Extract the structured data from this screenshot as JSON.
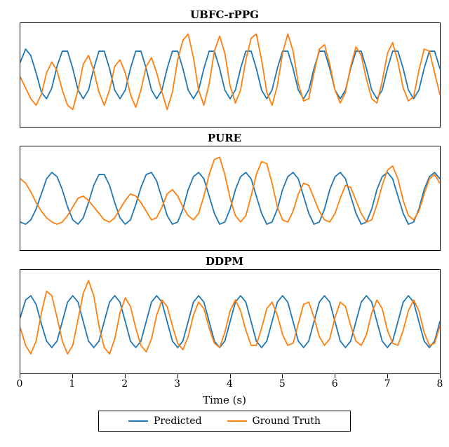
{
  "chart_data": [
    {
      "type": "line",
      "title": "UBFC-rPPG",
      "xlabel": "Time (s)",
      "ylabel": "",
      "xlim": [
        0,
        8
      ],
      "ylim": [
        -1.2,
        1.2
      ],
      "grid": false,
      "legend": {
        "entries": [
          "Predicted",
          "Ground Truth"
        ],
        "position": "bottom"
      },
      "series": [
        {
          "name": "Predicted",
          "color": "#1f77b4",
          "x": [
            0.0,
            0.1,
            0.2,
            0.3,
            0.4,
            0.5,
            0.6,
            0.7,
            0.8,
            0.9,
            1.0,
            1.1,
            1.2,
            1.3,
            1.4,
            1.5,
            1.6,
            1.7,
            1.8,
            1.9,
            2.0,
            2.1,
            2.2,
            2.3,
            2.4,
            2.5,
            2.6,
            2.7,
            2.8,
            2.9,
            3.0,
            3.1,
            3.2,
            3.3,
            3.4,
            3.5,
            3.6,
            3.7,
            3.8,
            3.9,
            4.0,
            4.1,
            4.2,
            4.3,
            4.4,
            4.5,
            4.6,
            4.7,
            4.8,
            4.9,
            5.0,
            5.1,
            5.2,
            5.3,
            5.4,
            5.5,
            5.6,
            5.7,
            5.8,
            5.9,
            6.0,
            6.1,
            6.2,
            6.3,
            6.4,
            6.5,
            6.6,
            6.7,
            6.8,
            6.9,
            7.0,
            7.1,
            7.2,
            7.3,
            7.4,
            7.5,
            7.6,
            7.7,
            7.8,
            7.9,
            8.0
          ],
          "values": [
            0.3,
            0.6,
            0.45,
            0.05,
            -0.4,
            -0.55,
            -0.3,
            0.2,
            0.55,
            0.55,
            0.15,
            -0.35,
            -0.55,
            -0.35,
            0.15,
            0.55,
            0.55,
            0.15,
            -0.35,
            -0.55,
            -0.35,
            0.15,
            0.55,
            0.55,
            0.15,
            -0.35,
            -0.55,
            -0.35,
            0.15,
            0.55,
            0.55,
            0.15,
            -0.35,
            -0.55,
            -0.35,
            0.15,
            0.55,
            0.55,
            0.15,
            -0.35,
            -0.55,
            -0.35,
            0.15,
            0.55,
            0.55,
            0.15,
            -0.35,
            -0.55,
            -0.35,
            0.15,
            0.55,
            0.55,
            0.15,
            -0.35,
            -0.55,
            -0.35,
            0.15,
            0.55,
            0.55,
            0.15,
            -0.35,
            -0.55,
            -0.35,
            0.15,
            0.55,
            0.55,
            0.15,
            -0.35,
            -0.55,
            -0.35,
            0.15,
            0.55,
            0.55,
            0.15,
            -0.35,
            -0.55,
            -0.35,
            0.15,
            0.55,
            0.55,
            0.15
          ]
        },
        {
          "name": "Ground Truth",
          "color": "#ff7f0e",
          "x": [
            0.0,
            0.1,
            0.2,
            0.3,
            0.4,
            0.5,
            0.6,
            0.7,
            0.8,
            0.9,
            1.0,
            1.1,
            1.2,
            1.3,
            1.4,
            1.5,
            1.6,
            1.7,
            1.8,
            1.9,
            2.0,
            2.1,
            2.2,
            2.3,
            2.4,
            2.5,
            2.6,
            2.7,
            2.8,
            2.9,
            3.0,
            3.1,
            3.2,
            3.3,
            3.4,
            3.5,
            3.6,
            3.7,
            3.8,
            3.9,
            4.0,
            4.1,
            4.2,
            4.3,
            4.4,
            4.5,
            4.6,
            4.7,
            4.8,
            4.9,
            5.0,
            5.1,
            5.2,
            5.3,
            5.4,
            5.5,
            5.6,
            5.7,
            5.8,
            5.9,
            6.0,
            6.1,
            6.2,
            6.3,
            6.4,
            6.5,
            6.6,
            6.7,
            6.8,
            6.9,
            7.0,
            7.1,
            7.2,
            7.3,
            7.4,
            7.5,
            7.6,
            7.7,
            7.8,
            7.9,
            8.0
          ],
          "values": [
            -0.05,
            -0.3,
            -0.55,
            -0.7,
            -0.45,
            0.05,
            0.3,
            0.1,
            -0.35,
            -0.7,
            -0.8,
            -0.35,
            0.25,
            0.45,
            0.1,
            -0.4,
            -0.7,
            -0.35,
            0.2,
            0.35,
            0.05,
            -0.45,
            -0.75,
            -0.35,
            0.2,
            0.4,
            0.05,
            -0.4,
            -0.8,
            -0.4,
            0.35,
            0.8,
            0.95,
            0.4,
            -0.35,
            -0.7,
            -0.2,
            0.55,
            0.9,
            0.5,
            -0.25,
            -0.65,
            -0.35,
            0.35,
            0.85,
            0.95,
            0.35,
            -0.4,
            -0.7,
            -0.25,
            0.5,
            0.95,
            0.55,
            -0.2,
            -0.6,
            -0.55,
            0.05,
            0.6,
            0.7,
            0.25,
            -0.35,
            -0.65,
            -0.4,
            0.2,
            0.65,
            0.45,
            -0.1,
            -0.55,
            -0.65,
            -0.15,
            0.5,
            0.75,
            0.3,
            -0.3,
            -0.6,
            -0.5,
            0.1,
            0.6,
            0.55,
            0.05,
            -0.45
          ]
        }
      ]
    },
    {
      "type": "line",
      "title": "PURE",
      "xlabel": "Time (s)",
      "ylabel": "",
      "xlim": [
        0,
        8
      ],
      "ylim": [
        -1.2,
        1.2
      ],
      "grid": false,
      "legend": {
        "entries": [
          "Predicted",
          "Ground Truth"
        ],
        "position": "bottom"
      },
      "series": [
        {
          "name": "Predicted",
          "color": "#1f77b4",
          "x": [
            0.0,
            0.1,
            0.2,
            0.3,
            0.4,
            0.5,
            0.6,
            0.7,
            0.8,
            0.9,
            1.0,
            1.1,
            1.2,
            1.3,
            1.4,
            1.5,
            1.6,
            1.7,
            1.8,
            1.9,
            2.0,
            2.1,
            2.2,
            2.3,
            2.4,
            2.5,
            2.6,
            2.7,
            2.8,
            2.9,
            3.0,
            3.1,
            3.2,
            3.3,
            3.4,
            3.5,
            3.6,
            3.7,
            3.8,
            3.9,
            4.0,
            4.1,
            4.2,
            4.3,
            4.4,
            4.5,
            4.6,
            4.7,
            4.8,
            4.9,
            5.0,
            5.1,
            5.2,
            5.3,
            5.4,
            5.5,
            5.6,
            5.7,
            5.8,
            5.9,
            6.0,
            6.1,
            6.2,
            6.3,
            6.4,
            6.5,
            6.6,
            6.7,
            6.8,
            6.9,
            7.0,
            7.1,
            7.2,
            7.3,
            7.4,
            7.5,
            7.6,
            7.7,
            7.8,
            7.9,
            8.0
          ],
          "values": [
            -0.55,
            -0.6,
            -0.5,
            -0.25,
            0.1,
            0.45,
            0.6,
            0.5,
            0.2,
            -0.2,
            -0.5,
            -0.6,
            -0.45,
            -0.1,
            0.3,
            0.55,
            0.55,
            0.3,
            -0.1,
            -0.45,
            -0.6,
            -0.5,
            -0.15,
            0.25,
            0.55,
            0.6,
            0.4,
            0.0,
            -0.4,
            -0.6,
            -0.55,
            -0.25,
            0.2,
            0.5,
            0.6,
            0.45,
            0.05,
            -0.35,
            -0.6,
            -0.55,
            -0.25,
            0.2,
            0.5,
            0.6,
            0.45,
            0.05,
            -0.35,
            -0.6,
            -0.55,
            -0.25,
            0.2,
            0.5,
            0.6,
            0.45,
            0.05,
            -0.35,
            -0.6,
            -0.55,
            -0.25,
            0.2,
            0.5,
            0.6,
            0.45,
            0.05,
            -0.35,
            -0.6,
            -0.55,
            -0.25,
            0.2,
            0.5,
            0.6,
            0.45,
            0.05,
            -0.35,
            -0.6,
            -0.55,
            -0.25,
            0.2,
            0.5,
            0.6,
            0.45
          ]
        },
        {
          "name": "Ground Truth",
          "color": "#ff7f0e",
          "x": [
            0.0,
            0.1,
            0.2,
            0.3,
            0.4,
            0.5,
            0.6,
            0.7,
            0.8,
            0.9,
            1.0,
            1.1,
            1.2,
            1.3,
            1.4,
            1.5,
            1.6,
            1.7,
            1.8,
            1.9,
            2.0,
            2.1,
            2.2,
            2.3,
            2.4,
            2.5,
            2.6,
            2.7,
            2.8,
            2.9,
            3.0,
            3.1,
            3.2,
            3.3,
            3.4,
            3.5,
            3.6,
            3.7,
            3.8,
            3.9,
            4.0,
            4.1,
            4.2,
            4.3,
            4.4,
            4.5,
            4.6,
            4.7,
            4.8,
            4.9,
            5.0,
            5.1,
            5.2,
            5.3,
            5.4,
            5.5,
            5.6,
            5.7,
            5.8,
            5.9,
            6.0,
            6.1,
            6.2,
            6.3,
            6.4,
            6.5,
            6.6,
            6.7,
            6.8,
            6.9,
            7.0,
            7.1,
            7.2,
            7.3,
            7.4,
            7.5,
            7.6,
            7.7,
            7.8,
            7.9,
            8.0
          ],
          "values": [
            0.45,
            0.35,
            0.15,
            -0.1,
            -0.3,
            -0.45,
            -0.55,
            -0.6,
            -0.55,
            -0.4,
            -0.2,
            0.0,
            0.05,
            -0.05,
            -0.2,
            -0.35,
            -0.5,
            -0.55,
            -0.45,
            -0.25,
            -0.05,
            0.1,
            0.05,
            -0.1,
            -0.3,
            -0.5,
            -0.45,
            -0.2,
            0.1,
            0.2,
            0.05,
            -0.2,
            -0.4,
            -0.5,
            -0.35,
            0.05,
            0.55,
            0.9,
            0.95,
            0.55,
            0.0,
            -0.4,
            -0.55,
            -0.4,
            0.05,
            0.55,
            0.85,
            0.8,
            0.35,
            -0.2,
            -0.5,
            -0.55,
            -0.3,
            0.1,
            0.35,
            0.3,
            0.0,
            -0.3,
            -0.5,
            -0.55,
            -0.35,
            0.0,
            0.3,
            0.25,
            -0.05,
            -0.35,
            -0.55,
            -0.5,
            -0.15,
            0.3,
            0.65,
            0.75,
            0.45,
            -0.05,
            -0.4,
            -0.5,
            -0.3,
            0.1,
            0.45,
            0.55,
            0.35
          ]
        }
      ]
    },
    {
      "type": "line",
      "title": "DDPM",
      "xlabel": "Time (s)",
      "ylabel": "",
      "xlim": [
        0,
        8
      ],
      "ylim": [
        -1.2,
        1.2
      ],
      "grid": false,
      "legend": {
        "entries": [
          "Predicted",
          "Ground Truth"
        ],
        "position": "bottom"
      },
      "series": [
        {
          "name": "Predicted",
          "color": "#1f77b4",
          "x": [
            0.0,
            0.1,
            0.2,
            0.3,
            0.4,
            0.5,
            0.6,
            0.7,
            0.8,
            0.9,
            1.0,
            1.1,
            1.2,
            1.3,
            1.4,
            1.5,
            1.6,
            1.7,
            1.8,
            1.9,
            2.0,
            2.1,
            2.2,
            2.3,
            2.4,
            2.5,
            2.6,
            2.7,
            2.8,
            2.9,
            3.0,
            3.1,
            3.2,
            3.3,
            3.4,
            3.5,
            3.6,
            3.7,
            3.8,
            3.9,
            4.0,
            4.1,
            4.2,
            4.3,
            4.4,
            4.5,
            4.6,
            4.7,
            4.8,
            4.9,
            5.0,
            5.1,
            5.2,
            5.3,
            5.4,
            5.5,
            5.6,
            5.7,
            5.8,
            5.9,
            6.0,
            6.1,
            6.2,
            6.3,
            6.4,
            6.5,
            6.6,
            6.7,
            6.8,
            6.9,
            7.0,
            7.1,
            7.2,
            7.3,
            7.4,
            7.5,
            7.6,
            7.7,
            7.8,
            7.9,
            8.0
          ],
          "values": [
            0.1,
            0.5,
            0.6,
            0.4,
            -0.05,
            -0.45,
            -0.6,
            -0.45,
            0.0,
            0.45,
            0.6,
            0.45,
            0.0,
            -0.45,
            -0.6,
            -0.45,
            0.0,
            0.45,
            0.6,
            0.45,
            0.0,
            -0.45,
            -0.6,
            -0.45,
            0.0,
            0.45,
            0.6,
            0.45,
            0.0,
            -0.45,
            -0.6,
            -0.45,
            0.0,
            0.45,
            0.6,
            0.45,
            0.0,
            -0.45,
            -0.6,
            -0.45,
            0.0,
            0.45,
            0.6,
            0.45,
            0.0,
            -0.45,
            -0.6,
            -0.45,
            0.0,
            0.45,
            0.6,
            0.45,
            0.0,
            -0.45,
            -0.6,
            -0.45,
            0.0,
            0.45,
            0.6,
            0.45,
            0.0,
            -0.45,
            -0.6,
            -0.45,
            0.0,
            0.45,
            0.6,
            0.45,
            0.0,
            -0.45,
            -0.6,
            -0.45,
            0.0,
            0.45,
            0.6,
            0.45,
            0.0,
            -0.45,
            -0.6,
            -0.45,
            0.0
          ]
        },
        {
          "name": "Ground Truth",
          "color": "#ff7f0e",
          "x": [
            0.0,
            0.1,
            0.2,
            0.3,
            0.4,
            0.5,
            0.6,
            0.7,
            0.8,
            0.9,
            1.0,
            1.1,
            1.2,
            1.3,
            1.4,
            1.5,
            1.6,
            1.7,
            1.8,
            1.9,
            2.0,
            2.1,
            2.2,
            2.3,
            2.4,
            2.5,
            2.6,
            2.7,
            2.8,
            2.9,
            3.0,
            3.1,
            3.2,
            3.3,
            3.4,
            3.5,
            3.6,
            3.7,
            3.8,
            3.9,
            4.0,
            4.1,
            4.2,
            4.3,
            4.4,
            4.5,
            4.6,
            4.7,
            4.8,
            4.9,
            5.0,
            5.1,
            5.2,
            5.3,
            5.4,
            5.5,
            5.6,
            5.7,
            5.8,
            5.9,
            6.0,
            6.1,
            6.2,
            6.3,
            6.4,
            6.5,
            6.6,
            6.7,
            6.8,
            6.9,
            7.0,
            7.1,
            7.2,
            7.3,
            7.4,
            7.5,
            7.6,
            7.7,
            7.8,
            7.9,
            8.0
          ],
          "values": [
            -0.15,
            -0.55,
            -0.75,
            -0.45,
            0.2,
            0.7,
            0.6,
            0.1,
            -0.45,
            -0.75,
            -0.55,
            0.05,
            0.65,
            0.95,
            0.6,
            -0.1,
            -0.6,
            -0.75,
            -0.4,
            0.2,
            0.55,
            0.35,
            -0.15,
            -0.55,
            -0.7,
            -0.4,
            0.15,
            0.5,
            0.35,
            -0.1,
            -0.5,
            -0.65,
            -0.35,
            0.15,
            0.45,
            0.3,
            -0.15,
            -0.5,
            -0.6,
            -0.25,
            0.25,
            0.5,
            0.25,
            -0.2,
            -0.55,
            -0.55,
            -0.15,
            0.3,
            0.45,
            0.15,
            -0.3,
            -0.55,
            -0.5,
            -0.05,
            0.4,
            0.45,
            0.1,
            -0.35,
            -0.55,
            -0.4,
            0.1,
            0.45,
            0.35,
            -0.1,
            -0.45,
            -0.55,
            -0.3,
            0.2,
            0.5,
            0.3,
            -0.2,
            -0.5,
            -0.55,
            -0.2,
            0.25,
            0.5,
            0.25,
            -0.25,
            -0.55,
            -0.5,
            -0.1
          ]
        }
      ]
    }
  ],
  "xlabel": "Time (s)",
  "xticks": [
    0,
    1,
    2,
    3,
    4,
    5,
    6,
    7,
    8
  ],
  "legend": {
    "predicted": {
      "label": "Predicted",
      "color": "#1f77b4"
    },
    "ground_truth": {
      "label": "Ground Truth",
      "color": "#ff7f0e"
    }
  }
}
